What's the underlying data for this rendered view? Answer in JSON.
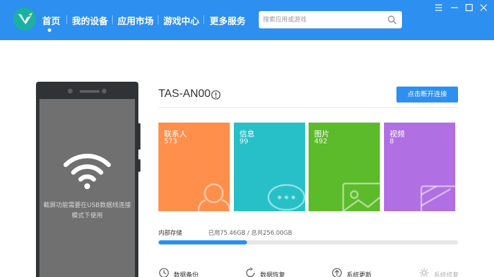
{
  "nav": {
    "items": [
      {
        "label": "首页",
        "active": true
      },
      {
        "label": "我的设备"
      },
      {
        "label": "应用市场"
      },
      {
        "label": "游戏中心"
      },
      {
        "label": "更多服务"
      }
    ]
  },
  "search": {
    "placeholder": "搜索应用或游戏",
    "value": ""
  },
  "window_controls": [
    "menu-icon",
    "minimize-icon",
    "maximize-icon",
    "close-icon"
  ],
  "phone": {
    "message": "截屏功能需要在USB数据线连接模式下使用"
  },
  "device": {
    "name": "TAS-AN00",
    "disconnect_label": "点击断开连接"
  },
  "tiles": [
    {
      "label": "联系人",
      "count": "573",
      "color": "#ff8f4b",
      "icon": "contact-icon"
    },
    {
      "label": "信息",
      "count": "99",
      "color": "#27c0c8",
      "icon": "message-icon"
    },
    {
      "label": "图片",
      "count": "492",
      "color": "#5cbb2a",
      "icon": "image-icon"
    },
    {
      "label": "视频",
      "count": "8",
      "color": "#b06fe3",
      "icon": "video-icon"
    }
  ],
  "storage": {
    "label": "内部存储",
    "value": "已用75.46GB / 总共256.00GB",
    "used_fraction": 0.2948
  },
  "actions": [
    {
      "label": "数据备份",
      "icon": "backup-icon"
    },
    {
      "label": "数据恢复",
      "icon": "restore-icon"
    },
    {
      "label": "系统更新",
      "icon": "update-icon"
    },
    {
      "label": "系统修复",
      "icon": "repair-icon",
      "disabled": true
    }
  ],
  "colors": {
    "accent": "#2d8ff0",
    "phone_body": "#2f3336",
    "phone_screen": "#707070"
  }
}
